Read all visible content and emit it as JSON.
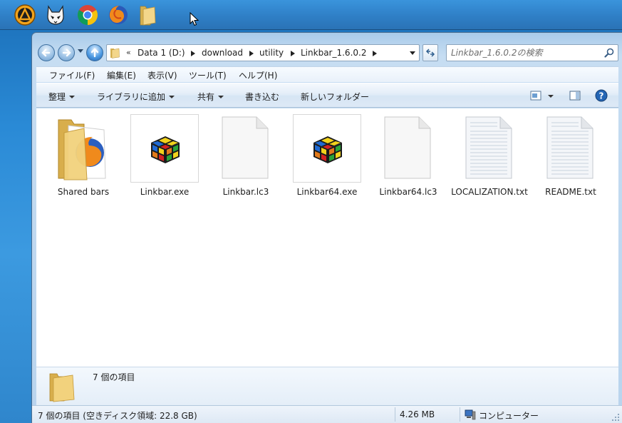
{
  "taskbar": {
    "icons": [
      "aimp-icon",
      "foobar-icon",
      "chrome-icon",
      "firefox-icon",
      "folder-icon"
    ]
  },
  "address": {
    "overflow": "«",
    "crumbs": [
      "Data 1 (D:)",
      "download",
      "utility",
      "Linkbar_1.6.0.2"
    ]
  },
  "search": {
    "placeholder": "Linkbar_1.6.0.2の検索"
  },
  "menu": {
    "file": "ファイル(F)",
    "edit": "編集(E)",
    "view": "表示(V)",
    "tools": "ツール(T)",
    "help": "ヘルプ(H)"
  },
  "commands": {
    "organize": "整理",
    "include_library": "ライブラリに追加",
    "share": "共有",
    "burn": "書き込む",
    "new_folder": "新しいフォルダー"
  },
  "files": [
    {
      "name": "Shared bars",
      "type": "folder"
    },
    {
      "name": "Linkbar.exe",
      "type": "exe"
    },
    {
      "name": "Linkbar.lc3",
      "type": "blank"
    },
    {
      "name": "Linkbar64.exe",
      "type": "exe"
    },
    {
      "name": "Linkbar64.lc3",
      "type": "blank"
    },
    {
      "name": "LOCALIZATION.txt",
      "type": "text"
    },
    {
      "name": "README.txt",
      "type": "text"
    }
  ],
  "details": {
    "count": "7 個の項目"
  },
  "status": {
    "left": "7 個の項目 (空きディスク領域: 22.8 GB)",
    "size": "4.26 MB",
    "location": "コンピューター"
  },
  "colors": {
    "accent": "#2f7fc6",
    "folder": "#e8c56a"
  }
}
